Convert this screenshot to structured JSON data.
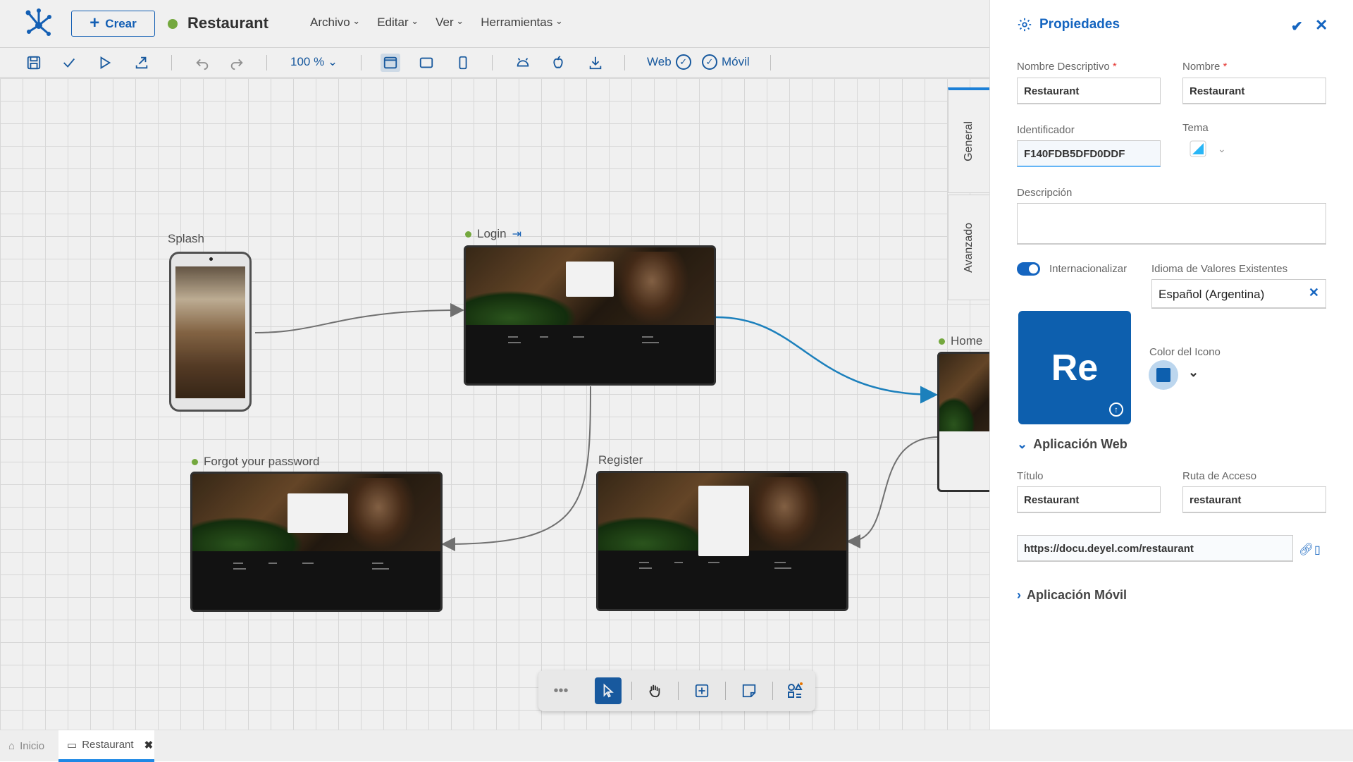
{
  "header": {
    "create_label": "Crear",
    "app_title": "Restaurant",
    "menus": [
      "Archivo",
      "Editar",
      "Ver",
      "Herramientas"
    ]
  },
  "toolbar": {
    "zoom": "100 %",
    "web_label": "Web",
    "movil_label": "Móvil"
  },
  "canvas": {
    "nodes": {
      "splash": "Splash",
      "login": "Login",
      "home": "Home",
      "forgot": "Forgot your password",
      "register": "Register"
    }
  },
  "side_tabs": [
    "General",
    "Avanzado"
  ],
  "panel": {
    "title": "Propiedades",
    "nombre_descriptivo_label": "Nombre Descriptivo",
    "nombre_descriptivo_value": "Restaurant",
    "nombre_label": "Nombre",
    "nombre_value": "Restaurant",
    "identificador_label": "Identificador",
    "identificador_value": "F140FDB5DFD0DDF",
    "tema_label": "Tema",
    "descripcion_label": "Descripción",
    "descripcion_value": "",
    "internacionalizar_label": "Internacionalizar",
    "internacionalizar_on": true,
    "idioma_label": "Idioma de Valores Existentes",
    "idioma_value": "Español (Argentina)",
    "icon_text": "Re",
    "icon_color": "#0d5fae",
    "color_icono_label": "Color del Icono",
    "web_section": "Aplicación Web",
    "titulo_label": "Título",
    "titulo_value": "Restaurant",
    "ruta_label": "Ruta de Acceso",
    "ruta_value": "restaurant",
    "url_value": "https://docu.deyel.com/restaurant",
    "movil_section": "Aplicación Móvil"
  },
  "bottom_tabs": [
    "Inicio",
    "Restaurant"
  ],
  "colors": {
    "accent": "#1565c0",
    "status_dot": "#7cb342",
    "edge_active": "#1e88c8"
  }
}
